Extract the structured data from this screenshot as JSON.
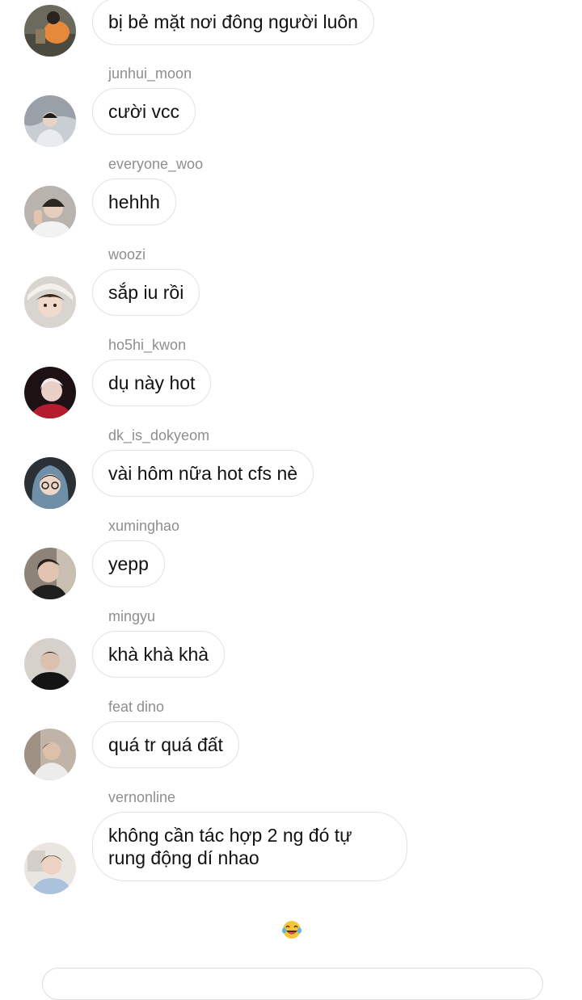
{
  "messages": [
    {
      "sender": "",
      "text": "bị bẻ mặt nơi đông người luôn"
    },
    {
      "sender": "junhui_moon",
      "text": "cười vcc"
    },
    {
      "sender": "everyone_woo",
      "text": "hehhh"
    },
    {
      "sender": "woozi",
      "text": "sắp iu rồi"
    },
    {
      "sender": "ho5hi_kwon",
      "text": "dụ này hot"
    },
    {
      "sender": "dk_is_dokyeom",
      "text": "vài hôm nữa hot cfs nè"
    },
    {
      "sender": "xuminghao",
      "text": "yepp"
    },
    {
      "sender": "mingyu",
      "text": "khà khà khà"
    },
    {
      "sender": "feat dino",
      "text": "quá tr quá đất"
    },
    {
      "sender": "vernonline",
      "text": "không cần tác hợp 2 ng đó tự rung động dí nhao"
    }
  ],
  "reaction": {
    "icon": "laughing-tears-emoji-icon"
  },
  "colors": {
    "sender_text": "#8e8e8e",
    "bubble_border": "#e2e2e2",
    "message_text": "#111111"
  }
}
